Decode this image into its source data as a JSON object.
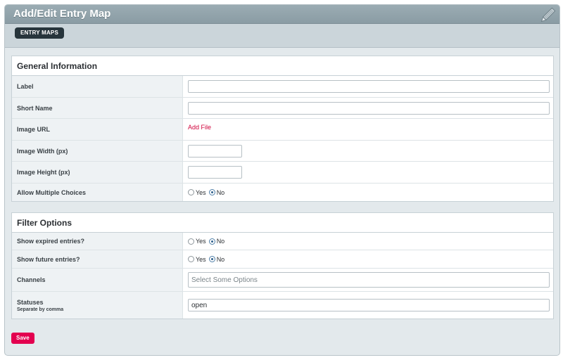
{
  "header": {
    "title": "Add/Edit Entry Map"
  },
  "subbar": {
    "entry_maps_label": "ENTRY MAPS"
  },
  "general": {
    "title": "General Information",
    "label_label": "Label",
    "label_value": "",
    "short_name_label": "Short Name",
    "short_name_value": "",
    "image_url_label": "Image URL",
    "add_file_label": "Add File",
    "image_width_label": "Image Width (px)",
    "image_width_value": "",
    "image_height_label": "Image Height (px)",
    "image_height_value": "",
    "allow_multiple_label": "Allow Multiple Choices",
    "allow_multiple_yes": "Yes",
    "allow_multiple_no": "No",
    "allow_multiple_selected": "No"
  },
  "filter": {
    "title": "Filter Options",
    "show_expired_label": "Show expired entries?",
    "show_expired_yes": "Yes",
    "show_expired_no": "No",
    "show_expired_selected": "No",
    "show_future_label": "Show future entries?",
    "show_future_yes": "Yes",
    "show_future_no": "No",
    "show_future_selected": "No",
    "channels_label": "Channels",
    "channels_placeholder": "Select Some Options",
    "statuses_label": "Statuses",
    "statuses_sublabel": "Separate by comma",
    "statuses_value": "open"
  },
  "actions": {
    "save_label": "Save"
  },
  "colors": {
    "accent": "#e3004f",
    "link": "#d0043c",
    "header_bg": "#9bacb3",
    "dark_pill": "#27353c"
  },
  "icons": {
    "header_icon": "pencil-icon"
  }
}
